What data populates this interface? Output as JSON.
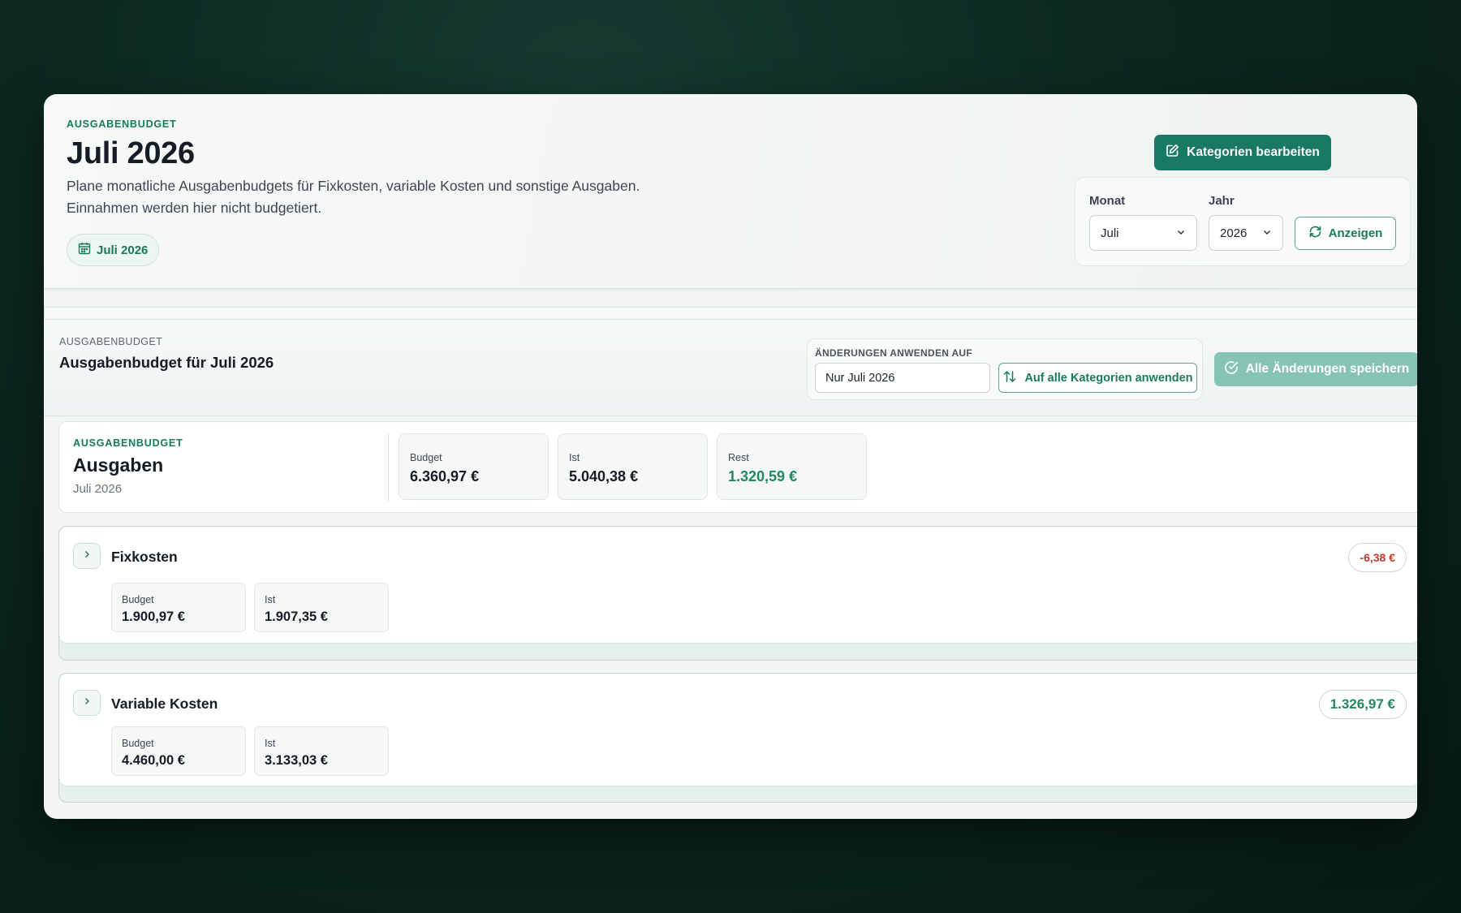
{
  "header": {
    "eyebrow": "AUSGABENBUDGET",
    "title": "Juli 2026",
    "description_line1": "Plane monatliche Ausgabenbudgets für Fixkosten, variable Kosten und sonstige Ausgaben.",
    "description_line2": "Einnahmen werden hier nicht budgetiert.",
    "chip_label": "Juli 2026",
    "edit_button": "Kategorien bearbeiten"
  },
  "filters": {
    "month_label": "Monat",
    "month_value": "Juli",
    "year_label": "Jahr",
    "year_value": "2026",
    "show_button": "Anzeigen"
  },
  "budget_panel": {
    "eyebrow": "AUSGABENBUDGET",
    "title": "Ausgabenbudget für Juli 2026",
    "apply_label": "ÄNDERUNGEN ANWENDEN AUF",
    "apply_value": "Nur Juli 2026",
    "apply_all_button": "Auf alle Kategorien anwenden",
    "save_button": "Alle Änderungen speichern"
  },
  "summary": {
    "eyebrow": "AUSGABENBUDGET",
    "title": "Ausgaben",
    "subtitle": "Juli 2026",
    "budget_label": "Budget",
    "budget_value": "6.360,97 €",
    "actual_label": "Ist",
    "actual_value": "5.040,38 €",
    "rest_label": "Rest",
    "rest_value": "1.320,59 €"
  },
  "categories": [
    {
      "name": "Fixkosten",
      "remaining": "-6,38 €",
      "budget_label": "Budget",
      "budget_value": "1.900,97 €",
      "actual_label": "Ist",
      "actual_value": "1.907,35 €"
    },
    {
      "name": "Variable Kosten",
      "remaining": "1.326,97 €",
      "budget_label": "Budget",
      "budget_value": "4.460,00 €",
      "actual_label": "Ist",
      "actual_value": "3.133,03 €"
    }
  ],
  "colors": {
    "accent": "#187a64",
    "positive": "#1e8a5e",
    "negative": "#c0392b",
    "save_disabled": "#86c3b5"
  }
}
